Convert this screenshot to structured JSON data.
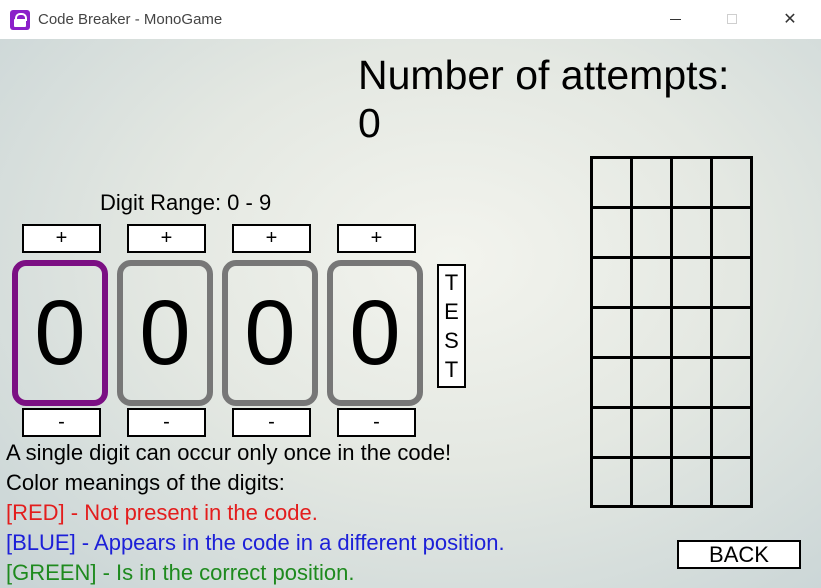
{
  "window": {
    "title": "Code Breaker - MonoGame",
    "minimize_glyph": "",
    "close_glyph": "✕"
  },
  "attempts": {
    "label": "Number of attempts:",
    "value": "0"
  },
  "digit_range": "Digit Range:  0 - 9",
  "digits": [
    {
      "value": "0",
      "plus": "+",
      "minus": "-"
    },
    {
      "value": "0",
      "plus": "+",
      "minus": "-"
    },
    {
      "value": "0",
      "plus": "+",
      "minus": "-"
    },
    {
      "value": "0",
      "plus": "+",
      "minus": "-"
    }
  ],
  "selected_digit_color": "#7b0f83",
  "test_button": {
    "letters": [
      "T",
      "E",
      "S",
      "T"
    ]
  },
  "messages": {
    "unique": "A single digit can occur only once in the code!",
    "color_meanings": "Color meanings of the digits:",
    "red": "[RED] - Not present in the code.",
    "blue": "[BLUE] - Appears in the code in a different position.",
    "green": "[GREEN] - Is in the correct position."
  },
  "colors": {
    "red": "#e31d1d",
    "blue": "#1d20d8",
    "green": "#1e8a1e"
  },
  "back_button": "BACK"
}
